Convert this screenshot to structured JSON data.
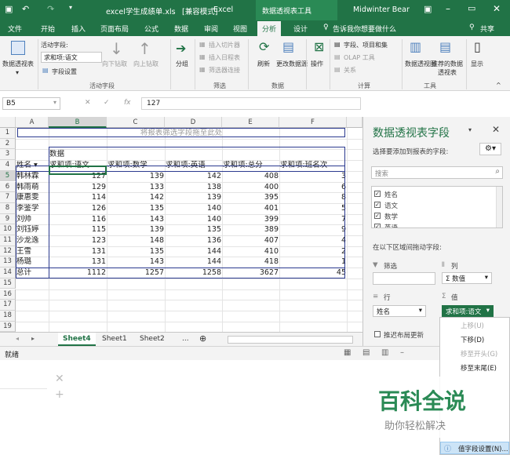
{
  "titlebar": {
    "filename": "excel学生成绩单.xls",
    "mode": "[兼容模式]",
    "app": "Excel",
    "context_tools": "数据透视表工具",
    "user": "Midwinter Bear"
  },
  "tabs": [
    "文件",
    "开始",
    "插入",
    "页面布局",
    "公式",
    "数据",
    "审阅",
    "视图",
    "分析",
    "设计"
  ],
  "active_tab": "分析",
  "tell_me": "告诉我你想要做什么",
  "share": "共享",
  "ribbon": {
    "pivottable": "数据透视表",
    "active_field_label": "活动字段:",
    "active_field_value": "求和项:语文",
    "field_settings": "字段设置",
    "drill_down": "向下钻取",
    "drill_up": "向上钻取",
    "group_active_field": "活动字段",
    "group_btn": "分组",
    "insert_slicer": "插入切片器",
    "insert_timeline": "插入日程表",
    "filter_connections": "筛选器连接",
    "group_filter": "筛选",
    "refresh": "刷新",
    "change_source": "更改数据源",
    "group_data": "数据",
    "actions": "操作",
    "fields_items_sets": "字段、项目和集",
    "olap_tools": "OLAP 工具",
    "relationships": "关系",
    "group_calc": "计算",
    "pivot_chart": "数据透视图",
    "recommended": "推荐的数据透视表",
    "group_tools": "工具",
    "show": "显示"
  },
  "formula_bar": {
    "name_box": "B5",
    "fx": "fx",
    "value": "127"
  },
  "columns": [
    "A",
    "B",
    "C",
    "D",
    "E",
    "F"
  ],
  "rows": [
    "1",
    "2",
    "3",
    "4",
    "5",
    "6",
    "7",
    "8",
    "9",
    "10",
    "11",
    "12",
    "13",
    "14",
    "15",
    "16",
    "17",
    "18",
    "19"
  ],
  "pivot": {
    "filter_hint": "将报表筛选字段拖至此处",
    "data_label": "数据",
    "row_header": "姓名",
    "headers": [
      "求和项:语文",
      "求和项:数学",
      "求和项:英语",
      "求和项:总分",
      "求和项:班名次"
    ],
    "names": [
      "韩林霖",
      "韩雨萌",
      "康惠雯",
      "李鉴学",
      "刘帅",
      "刘钰婷",
      "沙龙逸",
      "王雪",
      "杨璐"
    ],
    "values": [
      [
        127,
        139,
        142,
        408,
        3
      ],
      [
        129,
        133,
        138,
        400,
        6
      ],
      [
        114,
        142,
        139,
        395,
        8
      ],
      [
        126,
        135,
        140,
        401,
        5
      ],
      [
        116,
        143,
        140,
        399,
        7
      ],
      [
        115,
        139,
        135,
        389,
        9
      ],
      [
        123,
        148,
        136,
        407,
        4
      ],
      [
        131,
        135,
        144,
        410,
        2
      ],
      [
        131,
        143,
        144,
        418,
        1
      ]
    ],
    "total_label": "总计",
    "totals": [
      1112,
      1257,
      1258,
      3627,
      45
    ]
  },
  "sheet_tabs": [
    "Sheet4",
    "Sheet1",
    "Sheet2"
  ],
  "active_sheet": "Sheet4",
  "status": "就绪",
  "panel": {
    "title": "数据透视表字段",
    "prompt": "选择要添加到报表的字段:",
    "search_placeholder": "搜索",
    "fields": [
      "姓名",
      "语文",
      "数学",
      "英语"
    ],
    "areas_prompt": "在以下区域间拖动字段:",
    "filter": "筛选",
    "columns": "列",
    "rows": "行",
    "values": "值",
    "columns_item": "数值",
    "rows_item": "姓名",
    "values_item": "求和项:语文",
    "defer_update": "推迟布局更新"
  },
  "context_menu": {
    "items": [
      "上移(U)",
      "下移(D)",
      "移至开头(G)",
      "移至末尾(E)"
    ],
    "disabled": [
      0,
      2
    ],
    "bottom_item": "值字段设置(N)..."
  },
  "watermark": {
    "title": "百科全说",
    "subtitle": "助你轻松解决"
  }
}
